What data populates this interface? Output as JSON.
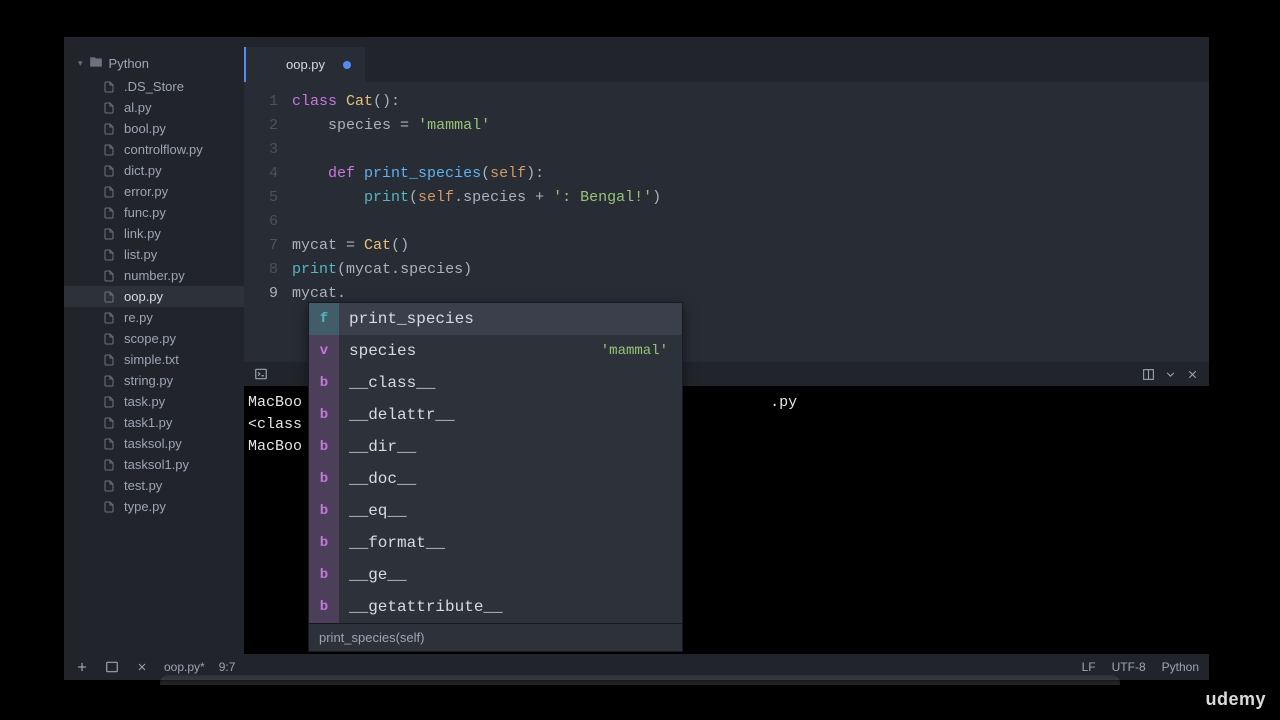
{
  "sidebar": {
    "folder": "Python",
    "files": [
      ".DS_Store",
      "al.py",
      "bool.py",
      "controlflow.py",
      "dict.py",
      "error.py",
      "func.py",
      "link.py",
      "list.py",
      "number.py",
      "oop.py",
      "re.py",
      "scope.py",
      "simple.txt",
      "string.py",
      "task.py",
      "task1.py",
      "tasksol.py",
      "tasksol1.py",
      "test.py",
      "type.py"
    ],
    "active_index": 10
  },
  "tab": {
    "title": "oop.py",
    "modified": true
  },
  "code": {
    "lines": [
      {
        "n": 1,
        "html": "<span class='kw'>class</span> <span class='cls'>Cat</span><span class='punct'>():</span>"
      },
      {
        "n": 2,
        "html": "    species <span class='punct'>=</span> <span class='str'>'mammal'</span>"
      },
      {
        "n": 3,
        "html": ""
      },
      {
        "n": 4,
        "html": "    <span class='kw'>def</span> <span class='fn'>print_species</span><span class='punct'>(</span><span class='param'>self</span><span class='punct'>):</span>"
      },
      {
        "n": 5,
        "html": "        <span class='builtin'>print</span><span class='punct'>(</span><span class='param'>self</span><span class='punct'>.</span>species <span class='punct'>+</span> <span class='str'>': Bengal!'</span><span class='punct'>)</span>"
      },
      {
        "n": 6,
        "html": ""
      },
      {
        "n": 7,
        "html": "mycat <span class='punct'>=</span> <span class='cls'>Cat</span><span class='punct'>()</span>"
      },
      {
        "n": 8,
        "html": "<span class='builtin'>print</span><span class='punct'>(</span>mycat<span class='punct'>.</span>species<span class='punct'>)</span>"
      },
      {
        "n": 9,
        "html": "mycat<span class='punct'>.</span>"
      }
    ],
    "current_line": 9
  },
  "autocomplete": {
    "items": [
      {
        "kind": "f",
        "label": "print_species",
        "hint": ""
      },
      {
        "kind": "v",
        "label": "species",
        "hint": "'mammal'"
      },
      {
        "kind": "b",
        "label": "__class__",
        "hint": ""
      },
      {
        "kind": "b",
        "label": "__delattr__",
        "hint": ""
      },
      {
        "kind": "b",
        "label": "__dir__",
        "hint": ""
      },
      {
        "kind": "b",
        "label": "__doc__",
        "hint": ""
      },
      {
        "kind": "b",
        "label": "__eq__",
        "hint": ""
      },
      {
        "kind": "b",
        "label": "__format__",
        "hint": ""
      },
      {
        "kind": "b",
        "label": "__ge__",
        "hint": ""
      },
      {
        "kind": "b",
        "label": "__getattribute__",
        "hint": ""
      }
    ],
    "selected_index": 0,
    "footer": "print_species(self)"
  },
  "terminal": {
    "lines": [
      "MacBoo",
      "<class",
      "MacBoo"
    ],
    "suffix": ".py"
  },
  "statusbar": {
    "filename": "oop.py*",
    "cursor": "9:7",
    "encoding": "LF",
    "charset": "UTF-8",
    "language": "Python"
  },
  "branding": "udemy"
}
